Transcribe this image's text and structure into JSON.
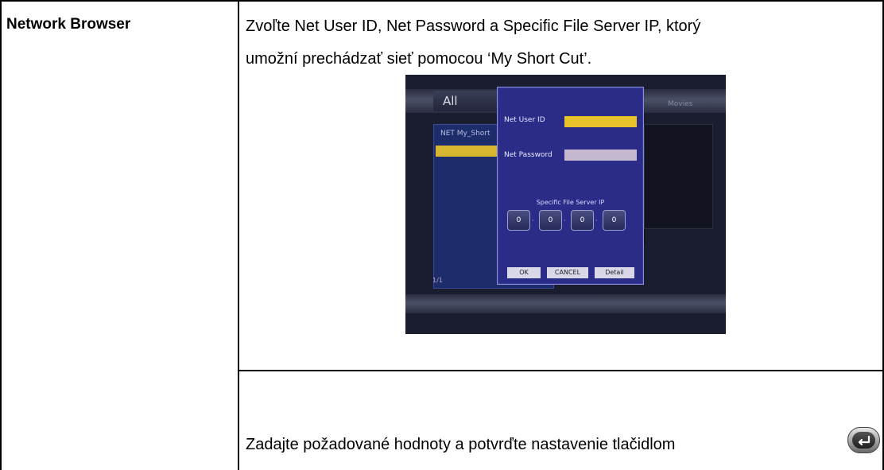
{
  "row_label": "Network Browser",
  "description_line1": "Zvoľte Net User ID, Net Password a Specific File Server IP, ktorý",
  "description_line2": "umožní prechádzať sieť pomocou ‘My Short Cut’.",
  "screenshot": {
    "tab_label": "All",
    "tab_right": "Movies",
    "list_header": "NET  My_Short",
    "page_indicator": "1/1",
    "dialog": {
      "net_user_id_label": "Net User ID",
      "net_password_label": "Net Password",
      "specific_ip_label": "Specific File Server IP",
      "ip_values": [
        "0",
        "0",
        "0",
        "0"
      ],
      "ok_label": "OK",
      "cancel_label": "CANCEL",
      "detail_label": "Detail",
      "user_field_color": "#e8c22a",
      "password_field_color": "#c4b8d0"
    }
  },
  "instruction": "Zadajte požadované hodnoty a potvrďte nastavenie tlačidlom",
  "enter_icon": "enter-button-icon"
}
